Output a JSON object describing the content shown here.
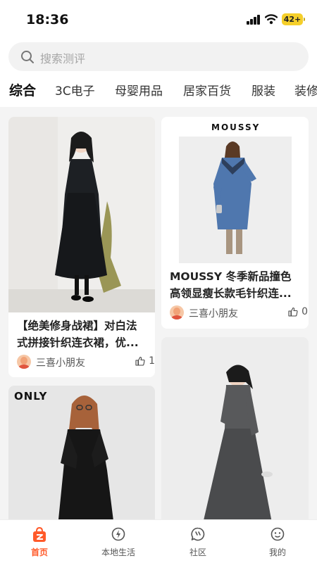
{
  "status_bar": {
    "time": "18:36",
    "battery": "42+"
  },
  "search": {
    "placeholder": "搜索测评"
  },
  "tabs": [
    "综合",
    "3C电子",
    "母婴用品",
    "居家百货",
    "服装",
    "装修"
  ],
  "feed": [
    {
      "title_line1": "【绝美修身战裙】对白法",
      "title_line2": "式拼接针织连衣裙，优...",
      "author": "三喜小朋友",
      "likes": "1"
    },
    {
      "brand": "MOUSSY",
      "title_line1": "MOUSSY 冬季新品撞色",
      "title_line2": "高领显瘦长款毛针织连...",
      "author": "三喜小朋友",
      "likes": "0"
    },
    {
      "brand": "ONLY"
    },
    {}
  ],
  "bottom_nav": [
    {
      "label": "首页",
      "icon": "home-bag-icon"
    },
    {
      "label": "本地生活",
      "icon": "lightning-icon"
    },
    {
      "label": "社区",
      "icon": "chat-icon"
    },
    {
      "label": "我的",
      "icon": "smile-face-icon"
    }
  ],
  "colors": {
    "accent": "#ff5a2a",
    "battery": "#f5cf2a"
  }
}
